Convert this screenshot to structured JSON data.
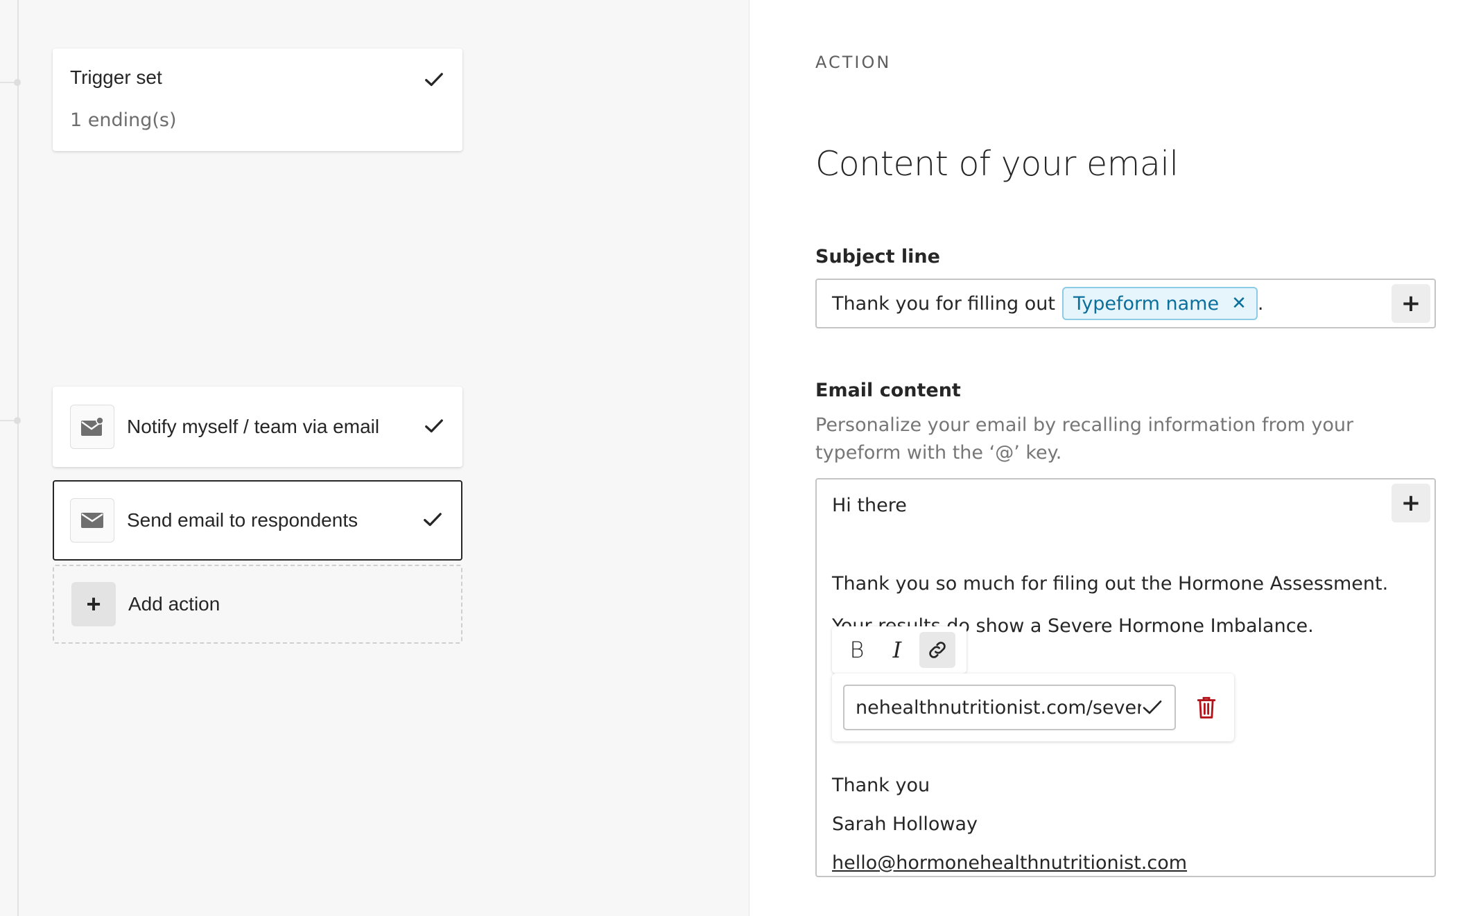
{
  "flow": {
    "trigger": {
      "title": "Trigger set",
      "subtitle": "1 ending(s)"
    },
    "actions": [
      {
        "label": "Notify myself / team via email"
      },
      {
        "label": "Send email to respondents"
      }
    ],
    "add_action_label": "Add action",
    "add_action_symbol": "+"
  },
  "panel": {
    "section_label": "ACTION",
    "heading": "Content of your email",
    "subject": {
      "label": "Subject line",
      "prefix_text": "Thank you for filling out",
      "chip_label": "Typeform name",
      "chip_remove": "✕",
      "suffix_text": ".",
      "add_symbol": "+"
    },
    "email": {
      "label": "Email content",
      "help_text": "Personalize your email by recalling information from your typeform with the ‘@’ key.",
      "add_symbol": "+",
      "lines": {
        "greeting": "Hi there",
        "thanks": "Thank you so much for filing out the Hormone Assessment.",
        "results": "Your results do show a Severe Hormone Imbalance.",
        "signoff": "Thank you",
        "name": "Sarah Holloway",
        "email_link": "hello@hormonehealthnutritionist.com"
      },
      "toolbar": {
        "bold": "B",
        "italic": "I"
      },
      "link_editor": {
        "url_value": "nehealthnutritionist.com/severe"
      }
    }
  },
  "colors": {
    "chip_bg": "#e6f5fb",
    "chip_text": "#0b6f9c",
    "delete_red": "#b3141c",
    "text": "#262627"
  }
}
